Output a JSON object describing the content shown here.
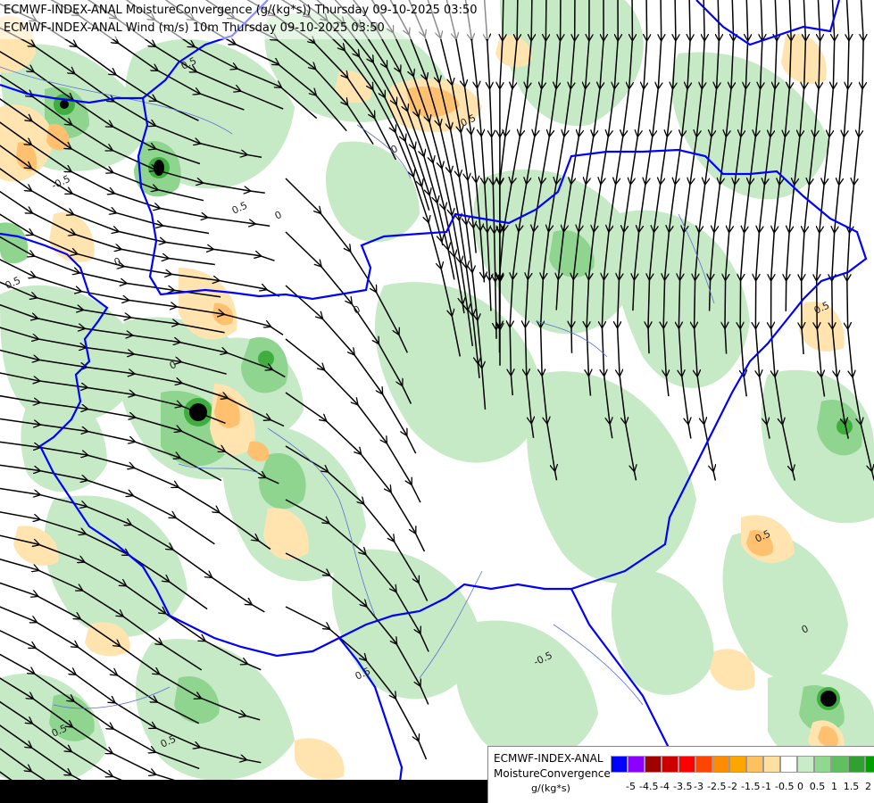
{
  "title": {
    "line1": "ECMWF-INDEX-ANAL MoistureConvergence (g/(kg*s)) Thursday 09-10-2025 03:50",
    "line2": "ECMWF-INDEX-ANAL Wind (m/s) 10m Thursday 09-10-2025 03:50"
  },
  "legend": {
    "model": "ECMWF-INDEX-ANAL",
    "parameter": "MoistureConvergence",
    "unit": "g/(kg*s)",
    "colors": [
      "#0000ff",
      "#8b00ff",
      "#a00000",
      "#cc0000",
      "#ff0000",
      "#ff4500",
      "#ff8c00",
      "#ffa500",
      "#ffc060",
      "#ffe0a0",
      "#ffffff",
      "#c8ecc8",
      "#90d890",
      "#60c060",
      "#30a030",
      "#00a000"
    ],
    "tick_labels": [
      "-5",
      "-4.5",
      "-4",
      "-3.5",
      "-3",
      "-2.5",
      "-2",
      "-1.5",
      "-1",
      "-0.5",
      "0",
      "0.5",
      "1",
      "1.5",
      "2"
    ]
  },
  "contour_labels": [
    "0.5",
    "0",
    "0.5",
    "0",
    "-0.5",
    "0.5",
    "0",
    "0.5",
    "0",
    "0.5",
    "0",
    "0.5",
    "-0.5",
    "0",
    "0.5",
    "0.5",
    "0.5"
  ],
  "colors": {
    "border": "#0000ff",
    "rivers": "#5a6fd8",
    "streamlines": "#000000",
    "green_light": "#c6eac6",
    "green_mid": "#8fd48f",
    "green_dark": "#3fae3f",
    "orange_light": "#ffe4b0",
    "orange_mid": "#ffc070"
  },
  "icons": [
    "streamline-arrow-icon"
  ]
}
